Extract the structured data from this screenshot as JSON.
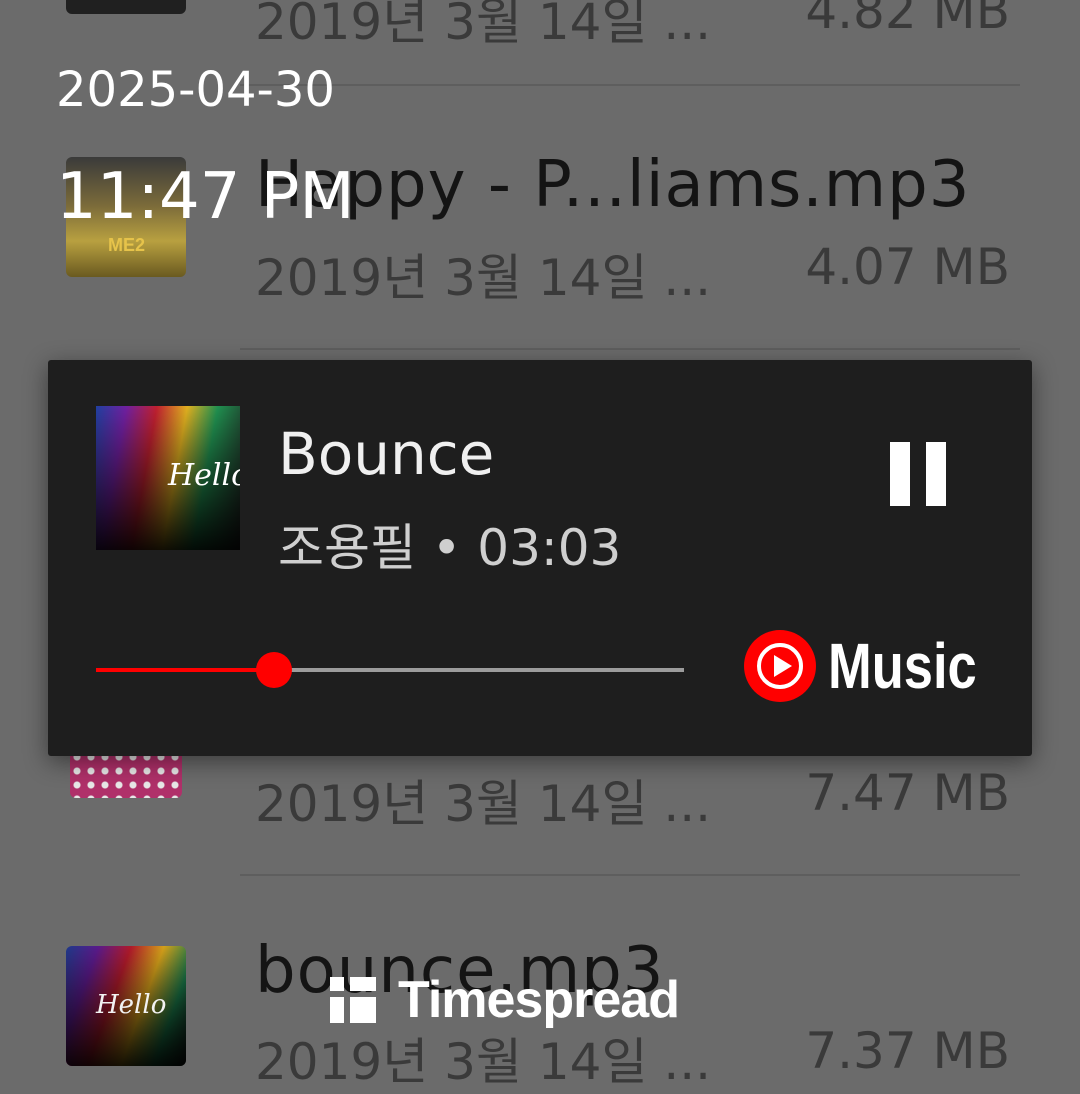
{
  "overlay": {
    "date": "2025-04-30",
    "time": "11:47 PM"
  },
  "file_list": {
    "rows": [
      {
        "name": "",
        "date": "2019년 3월 14일 ...",
        "size": "4.82 MB",
        "thumb": "album-art-image"
      },
      {
        "name": "Happy - P...liams.mp3",
        "date": "2019년 3월 14일 ...",
        "size": "4.07 MB",
        "thumb": "despicable-me-2-album-art"
      },
      {
        "name": "",
        "date": "2019년 3월 14일 ...",
        "size": "7.47 MB",
        "thumb": "polka-dot-album-art"
      },
      {
        "name": "bounce.mp3",
        "date": "2019년 3월 14일 ...",
        "size": "7.37 MB",
        "thumb": "hello-album-art"
      }
    ]
  },
  "player": {
    "album_text": "Hello",
    "title": "Bounce",
    "subtitle": "조용필 • 03:03",
    "progress_fraction": 0.302,
    "pause_icon": "pause-icon",
    "brand_icon": "youtube-music-play-icon",
    "brand_text": "Music",
    "colors": {
      "accent": "#ff0000",
      "card_bg": "#1e1e1e",
      "track": "#9c9c9c"
    }
  },
  "watermark": {
    "text": "Timespread",
    "icon": "timespread-logo-icon"
  }
}
